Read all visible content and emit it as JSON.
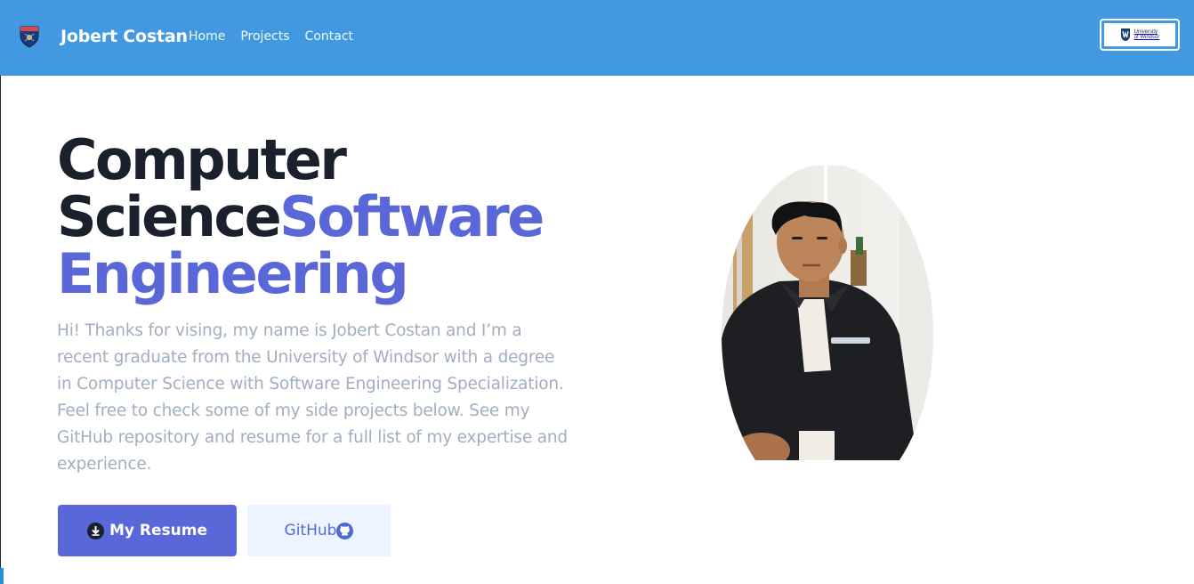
{
  "nav": {
    "brand_name": "Jobert Costan",
    "links": [
      "Home",
      "Projects",
      "Contact"
    ],
    "university_badge": {
      "line1": "University",
      "line2": "of Windsor"
    }
  },
  "hero": {
    "title_line1": "Computer",
    "title_line2a": "Science",
    "title_line2b": "Software",
    "title_line3": "Engineering",
    "intro": "Hi! Thanks for vising, my name is Jobert Costan and I’m a recent graduate from the University of Windsor with a degree in Computer Science with Software Engineering Specialization. Feel free to check some of my side projects below. See my GitHub repository and resume for a full list of my expertise and experience.",
    "resume_button": "My Resume",
    "github_button": "GitHub"
  },
  "icons": {
    "crest": "university-crest-icon",
    "uw_logo": "uwindsor-logo-icon",
    "resume": "download-icon",
    "github": "github-icon"
  },
  "colors": {
    "navbar": "#4299e1",
    "accent": "#5a67d8",
    "heading": "#1a202c",
    "body_text": "#a0aec0",
    "github_button_bg": "#ebf4ff"
  }
}
